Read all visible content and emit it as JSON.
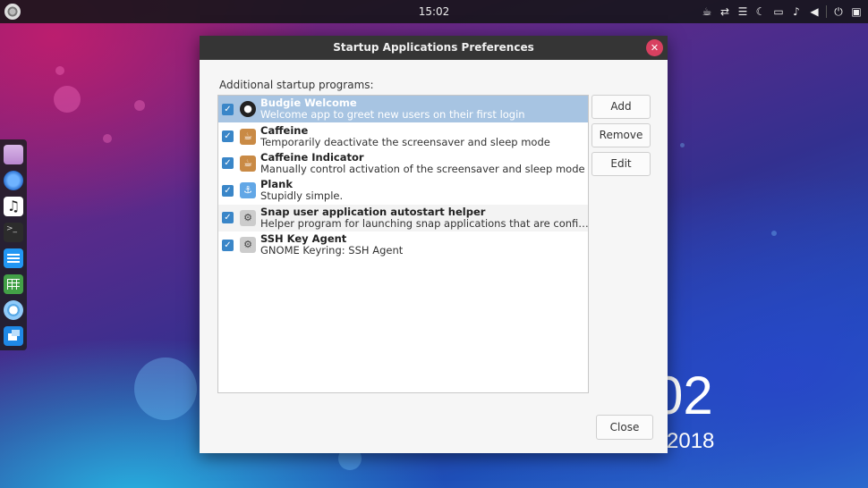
{
  "topbar": {
    "clock": "15:02",
    "tray_icons": [
      "caffeine-cup-icon",
      "network-transfer-icon",
      "notifications-list-icon",
      "night-light-icon",
      "folder-icon",
      "bell-icon",
      "volume-icon",
      "power-icon",
      "sidebar-toggle-icon"
    ]
  },
  "dock": {
    "items": [
      "files",
      "web-browser",
      "music-player",
      "terminal",
      "text-editor",
      "spreadsheet",
      "chromium",
      "window-switcher"
    ]
  },
  "desktop": {
    "time_fragment": "02",
    "date_fragment": "2018"
  },
  "dialog": {
    "title": "Startup Applications Preferences",
    "section_label": "Additional startup programs:",
    "programs": [
      {
        "name": "Budgie Welcome",
        "description": "Welcome app to greet new users on their first login",
        "checked": true,
        "selected": true,
        "icon": "budgie-ball-icon"
      },
      {
        "name": "Caffeine",
        "description": "Temporarily deactivate the screensaver and sleep mode",
        "checked": true,
        "selected": false,
        "icon": "caffeine-cup-icon"
      },
      {
        "name": "Caffeine Indicator",
        "description": "Manually control activation of the screensaver and sleep mode",
        "checked": true,
        "selected": false,
        "icon": "caffeine-cup-icon"
      },
      {
        "name": "Plank",
        "description": "Stupidly simple.",
        "checked": true,
        "selected": false,
        "icon": "anchor-icon"
      },
      {
        "name": "Snap user application autostart helper",
        "description": "Helper program for launching snap applications that are configured to …",
        "checked": true,
        "selected": false,
        "icon": "gear-icon"
      },
      {
        "name": "SSH Key Agent",
        "description": "GNOME Keyring: SSH Agent",
        "checked": true,
        "selected": false,
        "icon": "gear-icon"
      }
    ],
    "buttons": {
      "add": "Add",
      "remove": "Remove",
      "edit": "Edit",
      "close": "Close"
    }
  }
}
